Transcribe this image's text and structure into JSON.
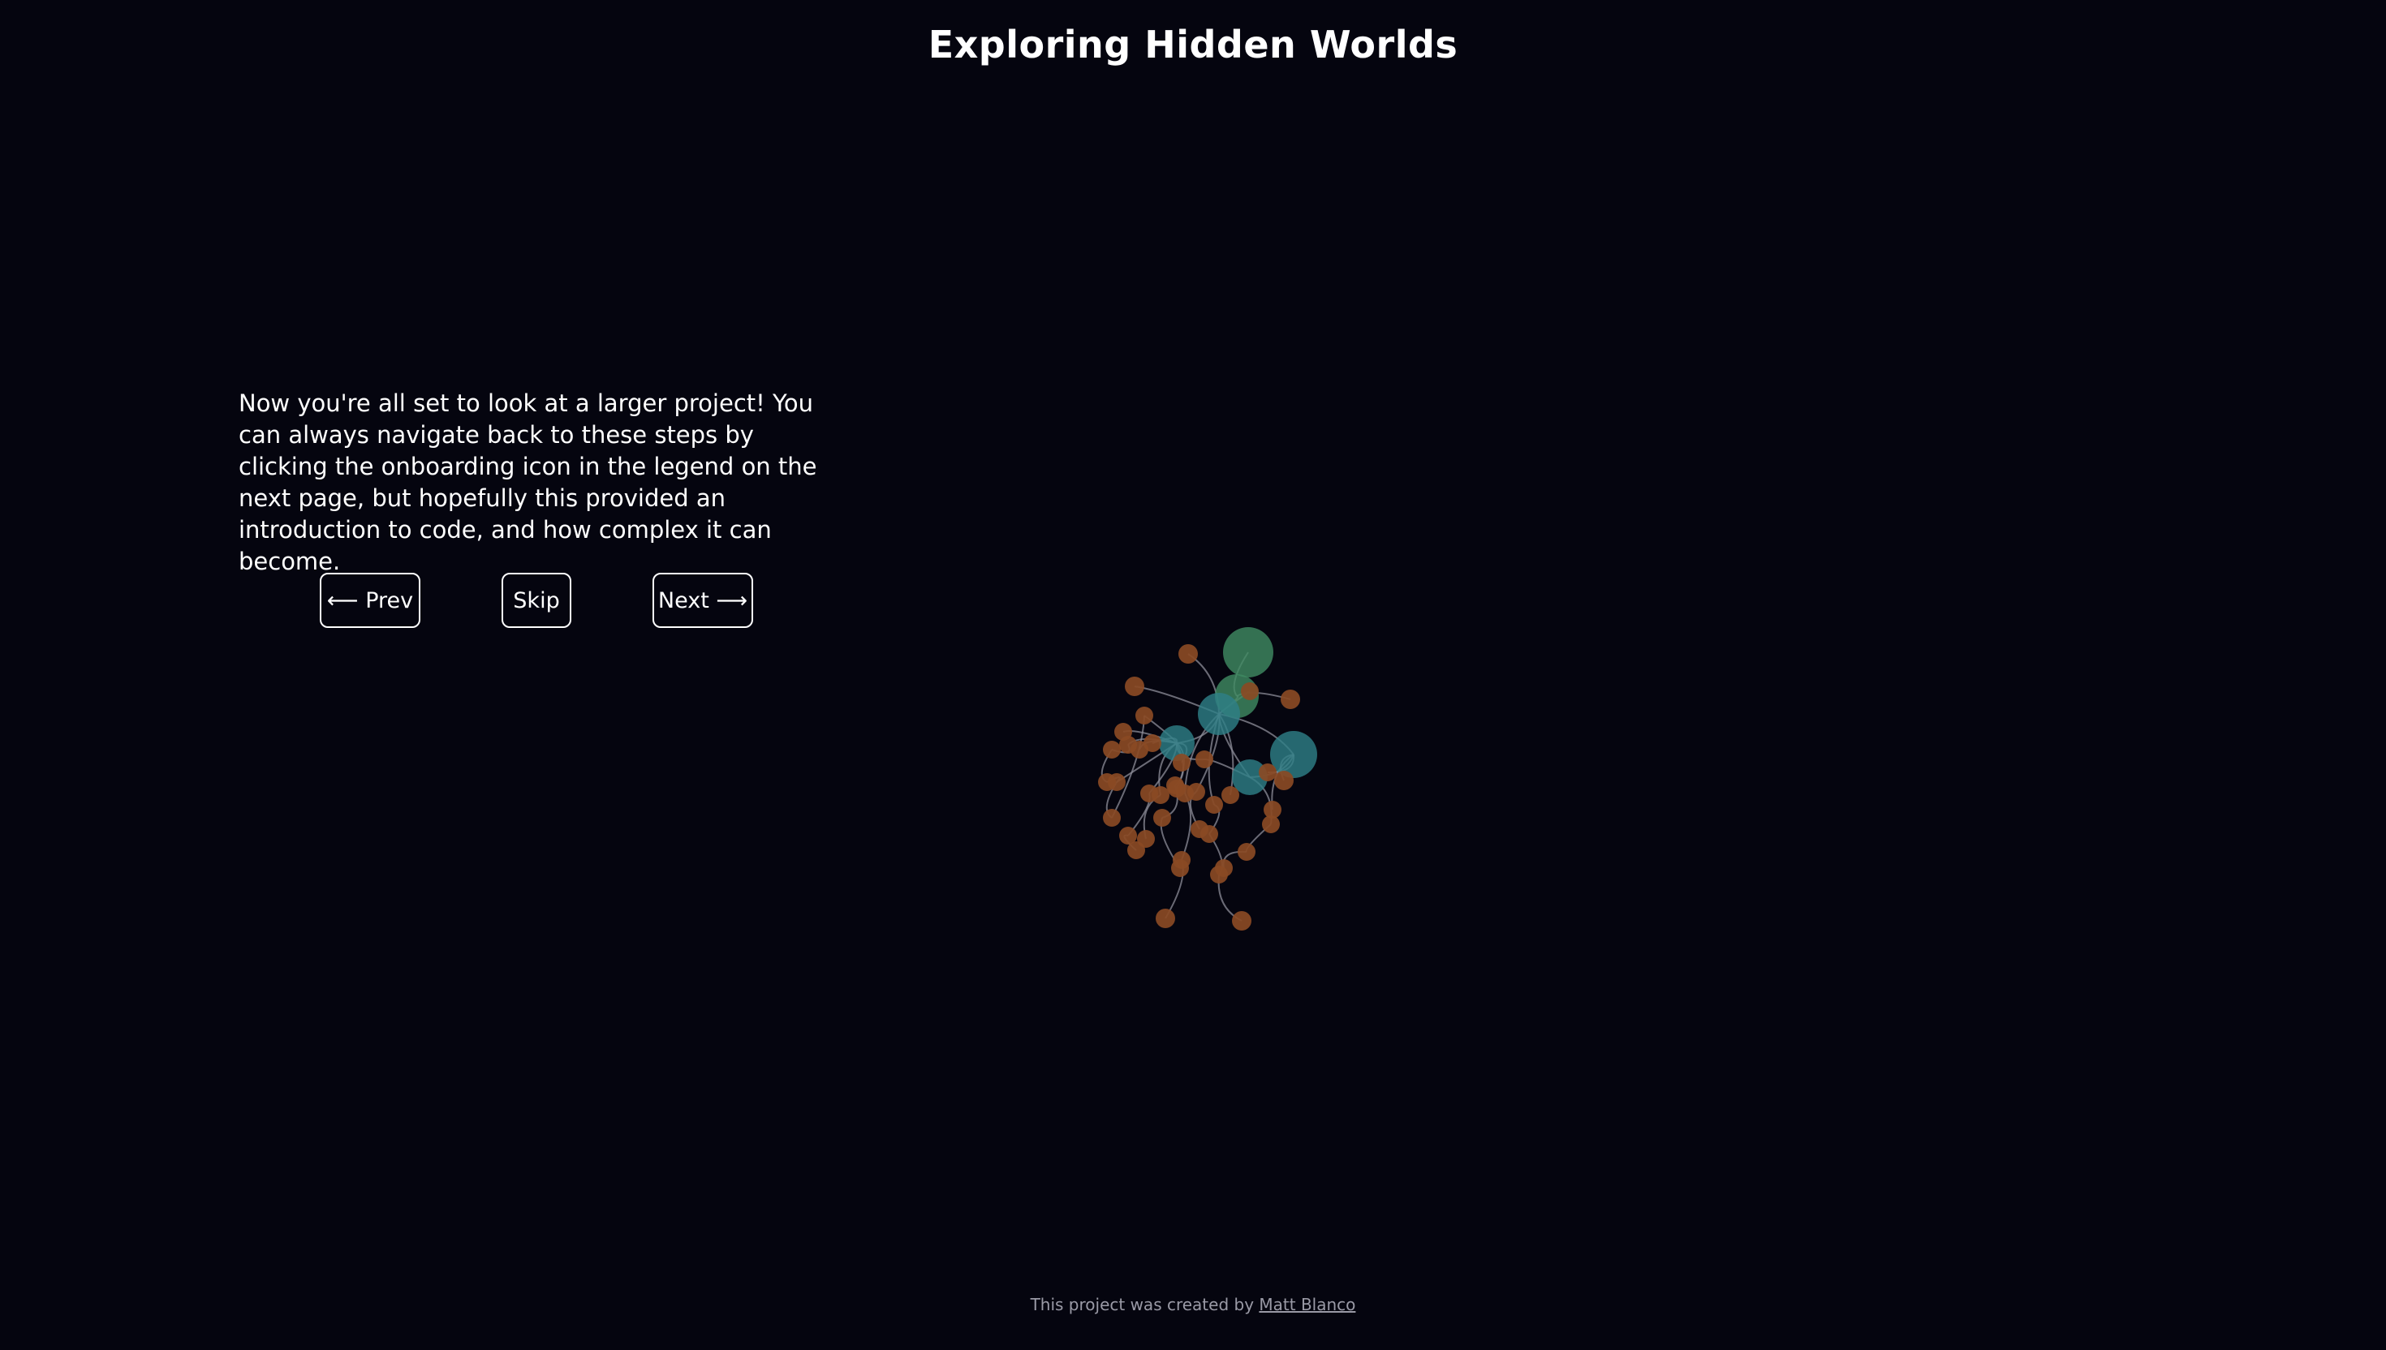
{
  "header": {
    "title": "Exploring Hidden Worlds"
  },
  "onboarding": {
    "text": "Now you're all set to look at a larger project! You can always navigate back to these steps by clicking the onboarding icon in the legend on the next page, but hopefully this provided an introduction to code, and how complex it can become.",
    "prev_arrow": "⟵",
    "prev_label": "Prev",
    "skip_label": "Skip",
    "next_label": "Next",
    "next_arrow": "⟶"
  },
  "footer": {
    "prefix": "This project was created by",
    "author": "Matt Blanco"
  },
  "colors": {
    "background": "#05050f",
    "node_file": "#8a4a24",
    "node_folder_green": "#3f8a62",
    "node_folder_teal": "#2e7f86",
    "link": "#8d8d9a"
  }
}
